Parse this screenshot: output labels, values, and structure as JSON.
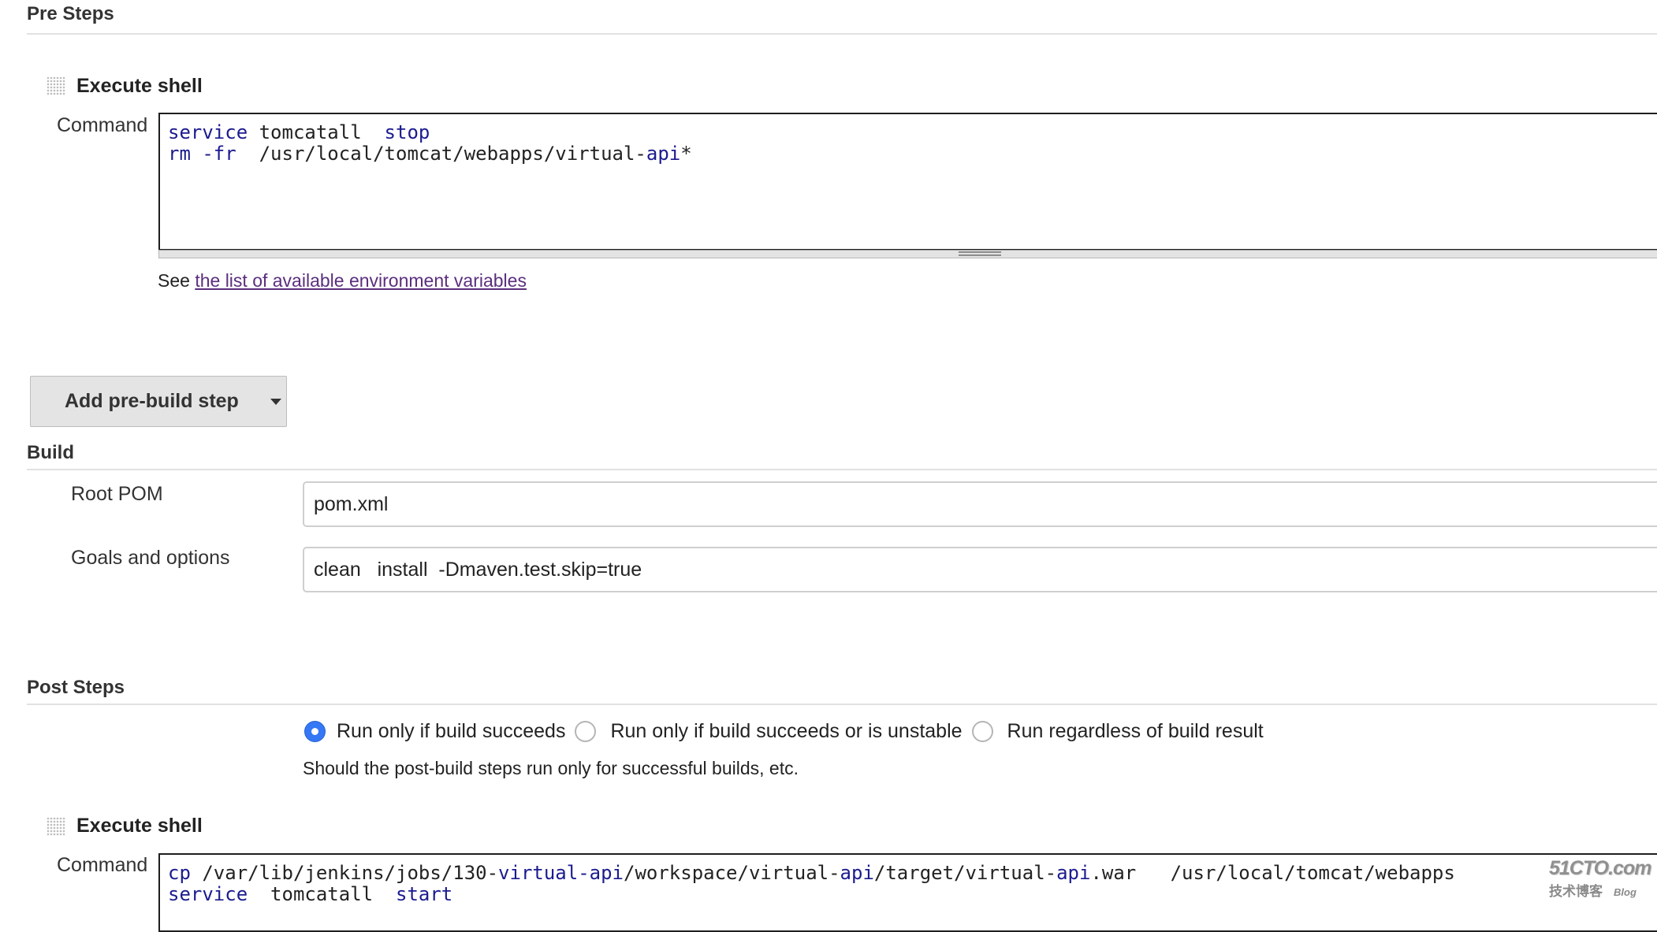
{
  "pre_steps": {
    "title": "Pre Steps",
    "step": {
      "title": "Execute shell",
      "command_label": "Command",
      "command_lines": [
        [
          {
            "t": "service",
            "k": true
          },
          {
            "t": " tomcatall  ",
            "k": false
          },
          {
            "t": "stop",
            "k": true
          }
        ],
        [
          {
            "t": "rm -fr",
            "k": true
          },
          {
            "t": "  /usr/local/tomcat/webapps/virtual-",
            "k": false
          },
          {
            "t": "api",
            "k": true
          },
          {
            "t": "*",
            "k": false
          }
        ]
      ],
      "help_prefix": "See ",
      "help_link": "the list of available environment variables"
    },
    "add_button": "Add pre-build step"
  },
  "build": {
    "title": "Build",
    "root_pom_label": "Root POM",
    "root_pom_value": "pom.xml",
    "goals_label": "Goals and options",
    "goals_value": "clean   install  -Dmaven.test.skip=true"
  },
  "post_steps": {
    "title": "Post Steps",
    "options": [
      {
        "label": "Run only if build succeeds",
        "selected": true
      },
      {
        "label": "Run only if build succeeds or is unstable",
        "selected": false
      },
      {
        "label": "Run regardless of build result",
        "selected": false
      }
    ],
    "help": "Should the post-build steps run only for successful builds, etc.",
    "step": {
      "title": "Execute shell",
      "command_label": "Command",
      "command_lines": [
        [
          {
            "t": "cp",
            "k": true
          },
          {
            "t": " /var/lib/jenkins/jobs/130-",
            "k": false
          },
          {
            "t": "virtual-api",
            "k": true
          },
          {
            "t": "/workspace/virtual-",
            "k": false
          },
          {
            "t": "api",
            "k": true
          },
          {
            "t": "/target/virtual-",
            "k": false
          },
          {
            "t": "api",
            "k": true
          },
          {
            "t": ".war   /usr/local/tomcat/webapps",
            "k": false
          }
        ],
        [
          {
            "t": "service",
            "k": true
          },
          {
            "t": "  tomcatall  ",
            "k": false
          },
          {
            "t": "start",
            "k": true
          }
        ]
      ]
    }
  },
  "watermark": {
    "site": "51CTO.com",
    "sub": "技术博客",
    "blog": "Blog"
  },
  "colors": {
    "radio_selected": "#3478f6",
    "code_keyword": "#1b1b8f",
    "link": "#5b2e7e"
  }
}
